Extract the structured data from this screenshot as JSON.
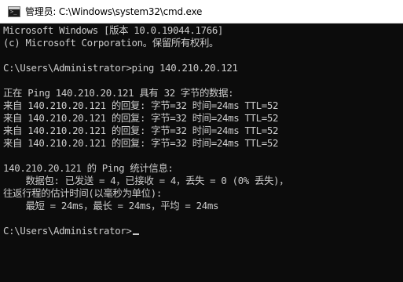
{
  "window": {
    "title": "管理员: C:\\Windows\\system32\\cmd.exe",
    "icon": "cmd-icon"
  },
  "console": {
    "lines": [
      "Microsoft Windows [版本 10.0.19044.1766]",
      "(c) Microsoft Corporation。保留所有权利。",
      "",
      "C:\\Users\\Administrator>ping 140.210.20.121",
      "",
      "正在 Ping 140.210.20.121 具有 32 字节的数据:",
      "来自 140.210.20.121 的回复: 字节=32 时间=24ms TTL=52",
      "来自 140.210.20.121 的回复: 字节=32 时间=24ms TTL=52",
      "来自 140.210.20.121 的回复: 字节=32 时间=24ms TTL=52",
      "来自 140.210.20.121 的回复: 字节=32 时间=24ms TTL=52",
      "",
      "140.210.20.121 的 Ping 统计信息:",
      "    数据包: 已发送 = 4，已接收 = 4，丢失 = 0 (0% 丢失)，",
      "往返行程的估计时间(以毫秒为单位):",
      "    最短 = 24ms，最长 = 24ms，平均 = 24ms",
      "",
      "C:\\Users\\Administrator>"
    ]
  },
  "colors": {
    "background": "#0c0c0c",
    "text": "#cccccc",
    "titlebar": "#ffffff"
  }
}
